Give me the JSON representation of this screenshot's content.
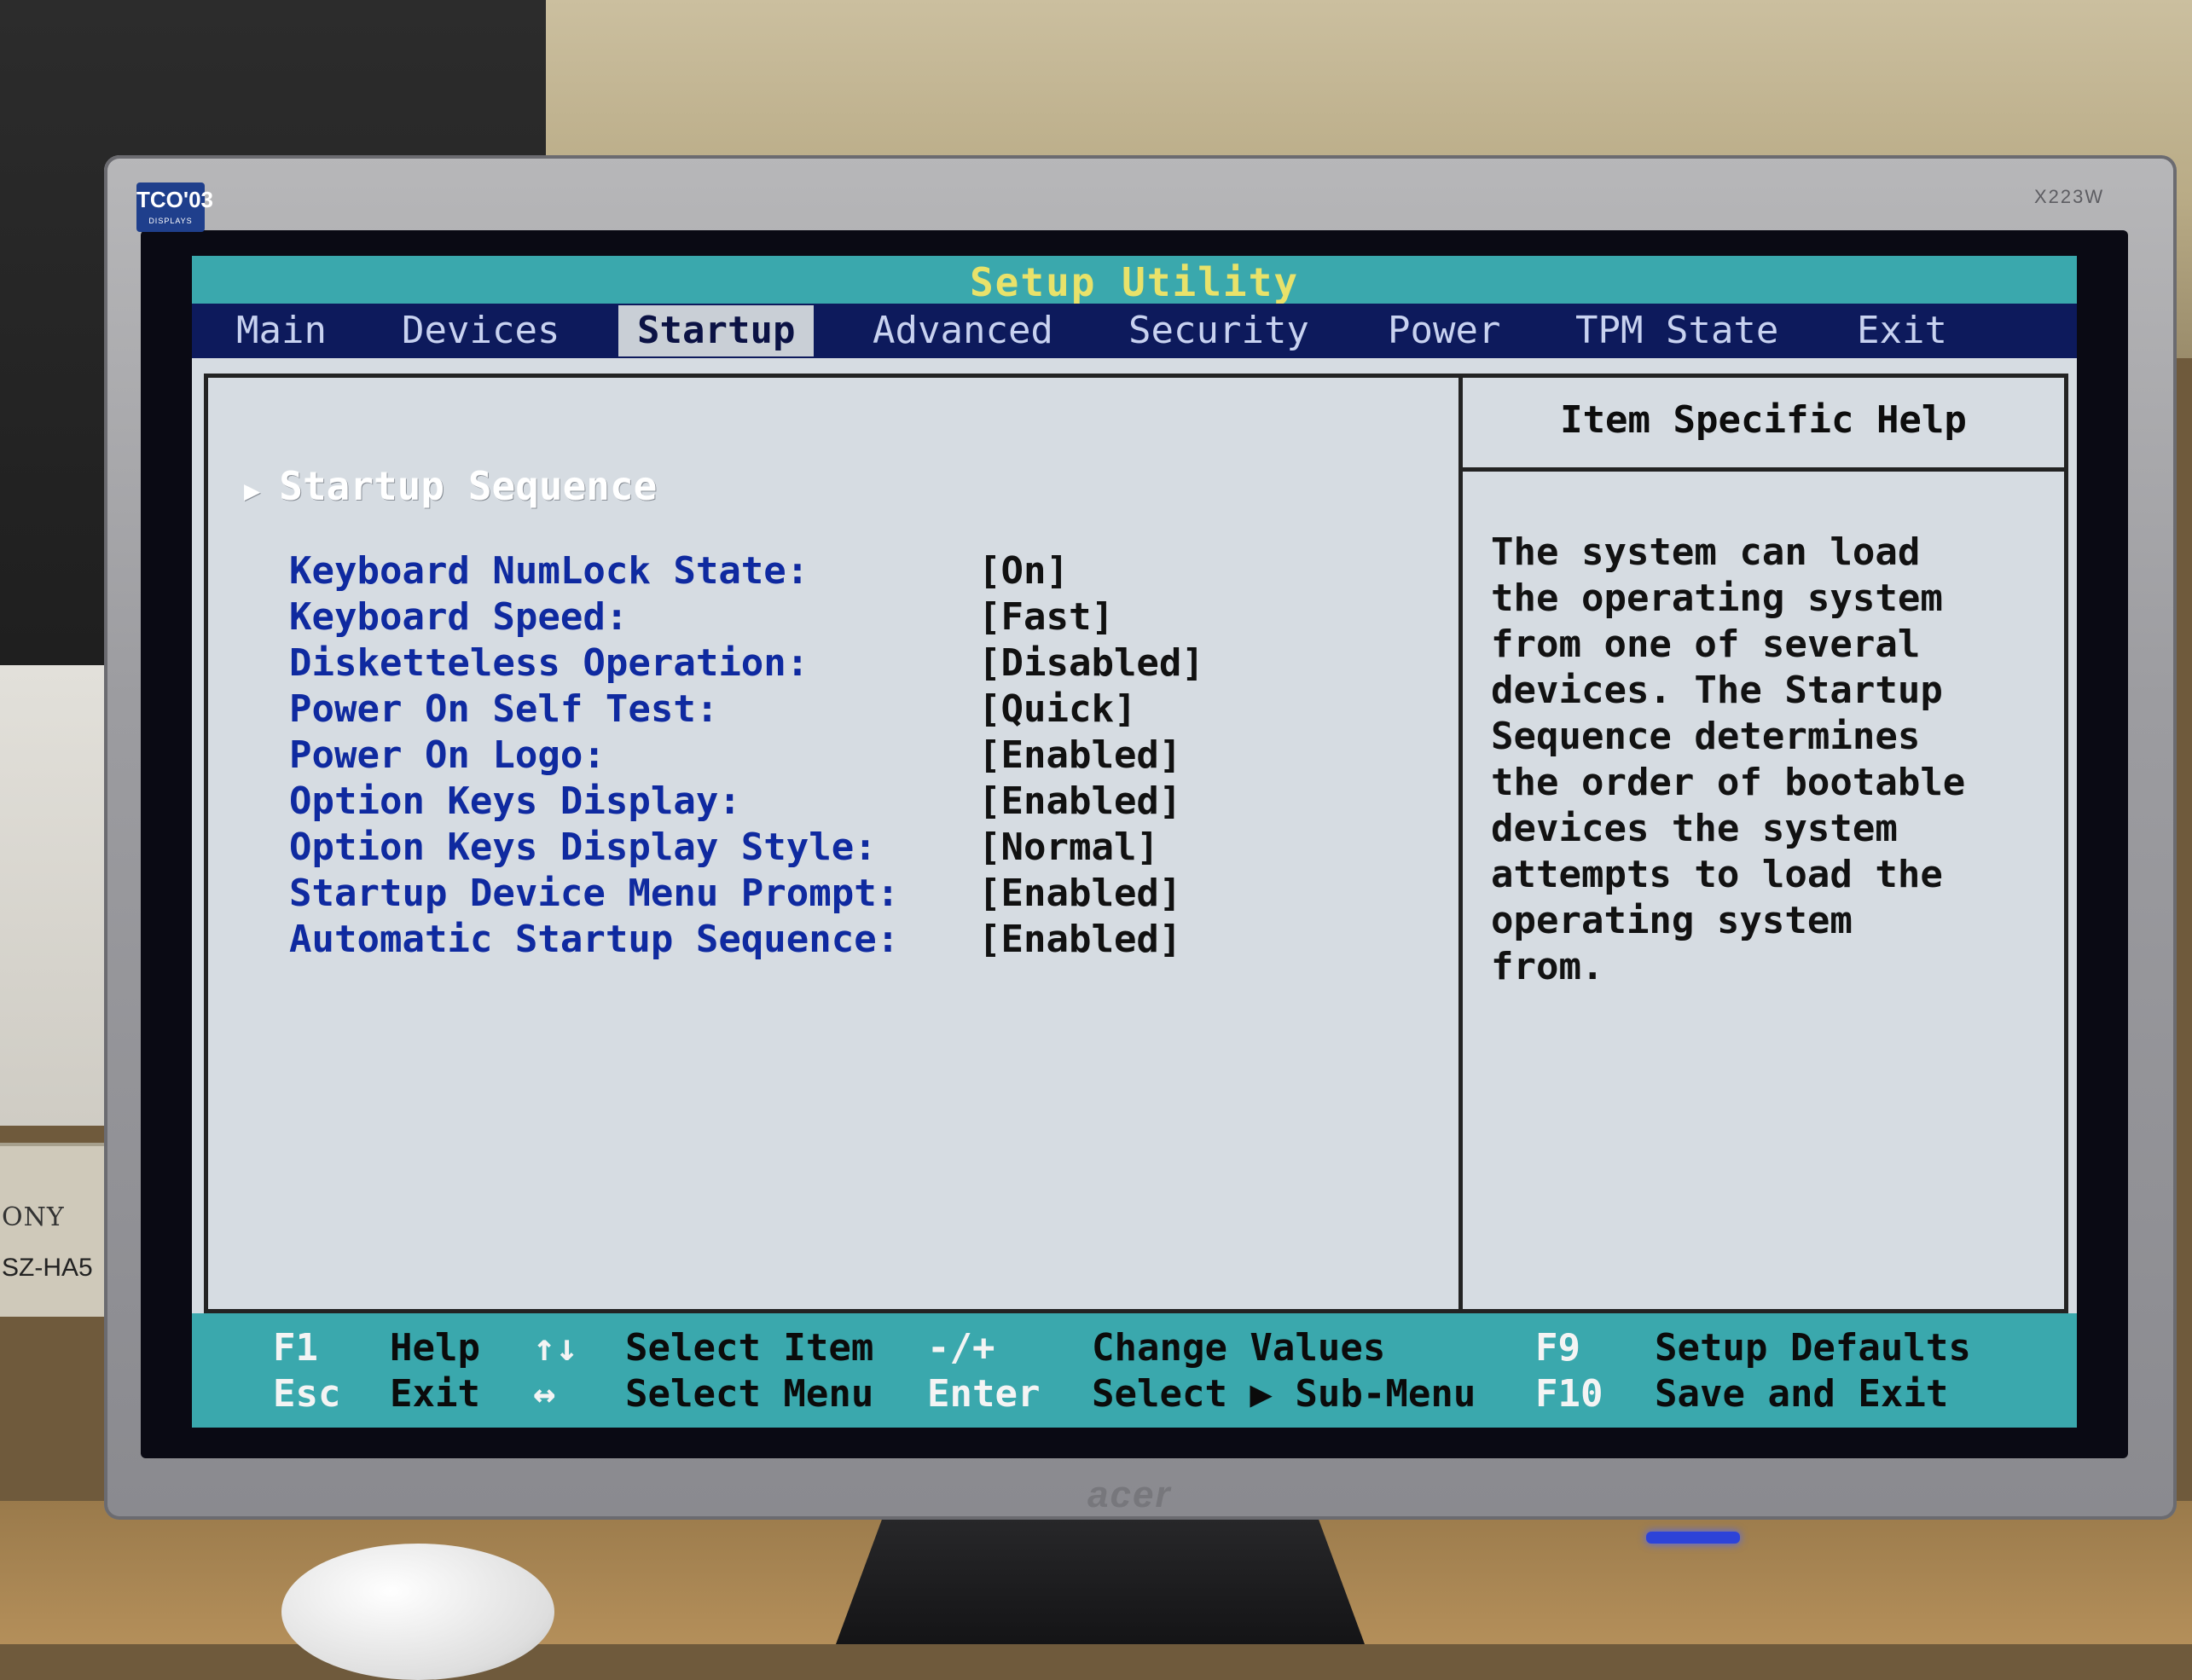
{
  "monitor": {
    "badge": "TCO'03",
    "badge_sub": "DISPLAYS",
    "model": "X223W",
    "brand": "acer"
  },
  "background": {
    "box_brand": "ONY",
    "box_model": "SZ-HA5"
  },
  "bios": {
    "title": "Setup Utility",
    "menu": [
      {
        "label": "Main",
        "active": false
      },
      {
        "label": "Devices",
        "active": false
      },
      {
        "label": "Startup",
        "active": true
      },
      {
        "label": "Advanced",
        "active": false
      },
      {
        "label": "Security",
        "active": false
      },
      {
        "label": "Power",
        "active": false
      },
      {
        "label": "TPM State",
        "active": false
      },
      {
        "label": "Exit",
        "active": false
      }
    ],
    "submenu": "Startup Sequence",
    "settings": [
      {
        "label": "Keyboard NumLock State:",
        "value": "[On]"
      },
      {
        "label": "Keyboard Speed:",
        "value": "[Fast]"
      },
      {
        "label": "Disketteless Operation:",
        "value": "[Disabled]"
      },
      {
        "label": "Power On Self Test:",
        "value": "[Quick]"
      },
      {
        "label": "Power On Logo:",
        "value": "[Enabled]"
      },
      {
        "label": "Option Keys Display:",
        "value": "[Enabled]"
      },
      {
        "label": "Option Keys Display Style:",
        "value": "[Normal]"
      },
      {
        "label": "Startup Device Menu Prompt:",
        "value": "[Enabled]"
      },
      {
        "label": "Automatic Startup Sequence:",
        "value": "[Enabled]"
      }
    ],
    "help": {
      "title": "Item Specific Help",
      "lines": [
        "The system can load",
        "the operating system",
        "from one of several",
        "devices. The Startup",
        "Sequence determines",
        "the order of bootable",
        "devices the system",
        "attempts to load the",
        "operating system",
        "from."
      ]
    },
    "footer": [
      {
        "key": "F1",
        "desc": "Help"
      },
      {
        "key": "Esc",
        "desc": "Exit"
      },
      {
        "key": "↑↓",
        "desc": "Select Item"
      },
      {
        "key": "↔",
        "desc": "Select Menu"
      },
      {
        "key": "-/+",
        "desc": "Change Values"
      },
      {
        "key": "Enter",
        "desc": "Select ▶ Sub-Menu"
      },
      {
        "key": "F9",
        "desc": "Setup Defaults"
      },
      {
        "key": "F10",
        "desc": "Save and Exit"
      }
    ]
  }
}
